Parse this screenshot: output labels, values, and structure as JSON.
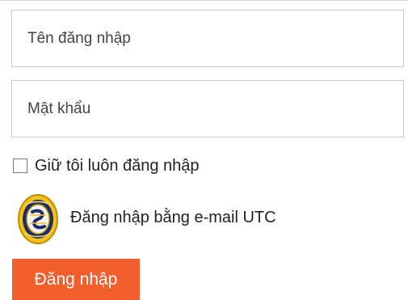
{
  "login_form": {
    "username": {
      "value": "",
      "placeholder": "Tên đăng nhập"
    },
    "password": {
      "value": "",
      "placeholder": "Mật khẩu"
    },
    "remember": {
      "label": "Giữ tôi luôn đăng nhập",
      "checked": false
    },
    "utc_login": {
      "icon": "utc-logo-icon",
      "label": "Đăng nhập bằng e-mail UTC"
    },
    "submit_label": "Đăng nhập"
  },
  "colors": {
    "submit_background": "#f25f2c",
    "field_border": "#c9c9c9",
    "logo_gold": "#f2c21a",
    "logo_navy": "#1d2d68"
  }
}
